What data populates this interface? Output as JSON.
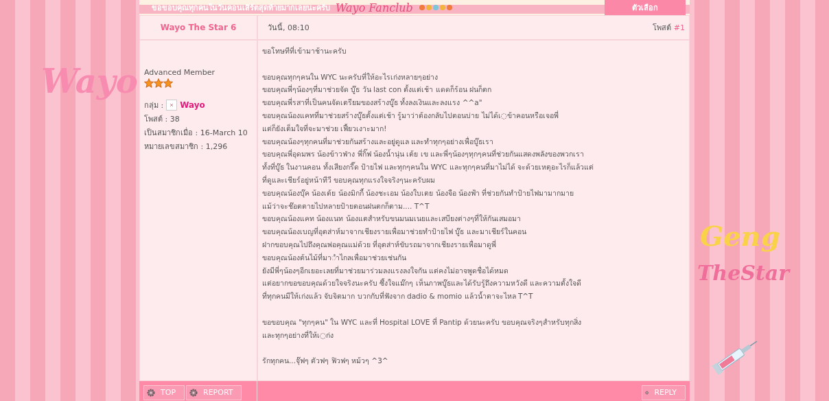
{
  "side_art": {
    "left": "Wayo",
    "right_top": "Geng",
    "right_bottom": "TheStar"
  },
  "header": {
    "title": "ขอขอบคุณทุกคนในวันคอนเสิร์ตสุดท้ายมากเลยนะครับ",
    "logo": "Wayo Fanclub",
    "options_button": "ตัวเลือก"
  },
  "post": {
    "author": "Wayo The Star 6",
    "time": "วันนี้, 08:10",
    "post_label": "โพสต์",
    "post_number": "#1",
    "member": {
      "rank": "Advanced Member",
      "stars": 3,
      "group_label": "กลุ่ม :",
      "group": "Wayo",
      "posts": "โพสต์ : 38",
      "joined": "เป็นสมาชิกเมื่อ : 16-March 10",
      "member_no": "หมายเลขสมาชิก : 1,296"
    },
    "paragraphs": [
      [
        "ขอโทษทีที่เข้ามาช้านะครับ"
      ],
      [
        "ขอบคุณทุกๆคนใน WYC นะครับที่ให้อะไรเก่งหลายๆอย่าง",
        "ขอบคุณพี่ๆน้องๆที่มาช่วยจัด บู๊ธ วัน last con ตั้งแต่เช้า แดดก็ร้อน ฝนก็ตก",
        "ขอบคุณพี่รสาที่เป็นคนจัดเตรียมของสร้างบู๊ธ ทั้งลงเงินและลงแรง ^^a\"",
        "ขอบคุณน้องแคทที่มาช่วยสร้างบู๊ธตั้งแต่เช้า รู้มาว่าต้องกลับไปตอนบ่าย ไม่ได้เ◌ข้าคอนหรือเจอพี่",
        "แต่ก็ยังเต็มใจที่จะมาช่วย เฟี้ยวเงาะมาก!",
        "ขอบคุณน้องๆทุกคนที่มาช่วยกันสร้างและอยู่ดูแล และทำทุกๆอย่างเพื่อบู๊ธเรา",
        "ขอบคุณพี่อุดมพร น้องข้าวฟ่าง พี่กิ๊ฟ น้องน้ำนุ่น เต้ย เข และพี่ๆน้องๆทุกๆคนที่ช่วยกันแสดงพลังของพวกเรา",
        "ทั้งที่บู๊ธ ในงานคอน ทั้งเสียงกรี๊ด ป้ายไฟ และทุกๆคนใน WYC และทุกๆคนที่มาไม่ได้ จะด้วยเหตุอะไรก็แล้วแต่",
        "ที่ดูและเชียร์อยู่หน้าทีวี ขอบคุณทุกแรงใจจริงๆนะครับผม",
        "ขอบคุณน้องบุ๊ค น้องเต้ย น้องมิกกี้ น้องชะเอม น้องใบเตย น้องจือ น้องฟ้า ที่ช่วยกันทำป้ายไฟมามากมาย",
        "แม้ว่าจะช๊อตตายไปหลายป้ายตอนฝนตกก็ตาม.... T^T",
        "ขอบคุณน้องแคท น้องแนท น้องแตสำหรับขนมนมเนยและเสบียงต่างๆที่ให้กันเสมอมา",
        "ขอบคุณน้องเบญที่อุตส่าห์มาจากเชียงรายเพื่อมาช่วยทำป้ายไฟ บู๊ธ และมาเชียร์ในคอน",
        "ฝากขอบคุณไปถึงคุณพ่อคุณแม่ด้วย ที่อุตส่าห์ขับรถมาจากเชียงรายเพื่อมาดูพี่",
        "ขอบคุณน้องต้นไม้ที่มา◌ำไกลเพื่อมาช่วยเช่นกัน",
        "ยังมีพี่ๆน้องๆอีกเยอะเลยที่มาช่วยมาร่วมลงแรงลงใจกัน แต่คงไม่อาจพูดชื่อได้หมด",
        "แต่อยากขอขอบคุณด้วยใจจริงนะครับ ซึ้งใจแม๊กๆ เห็นภาพบู๊ธและได้รับรู้ถึงความหวังดี และความตั้งใจดี",
        "ที่ทุกคนมีให้เก่งแล้ว จับจิตมาก บวกกับที่ฟังจาก dadio & momio แล้วน้ำตาจะไหล T^T"
      ],
      [
        "ขอขอบคุณ \"ทุกๆคน\" ใน WYC และที่ Hospital LOVE ที่ Pantip ด้วยนะครับ ขอบคุณจริงๆสำหรับทุกสิ่ง",
        "และทุกๆอย่างที่ให้เ◌ก่ง"
      ],
      [
        "รักทุกคน...จุ๊ฟๆ ตัวฟๆ ฟิวฟๆ หม้วๆ ^3^"
      ]
    ]
  },
  "footer": {
    "top_button": "TOP",
    "report_button": "REPORT",
    "reply_button": "REPLY"
  }
}
